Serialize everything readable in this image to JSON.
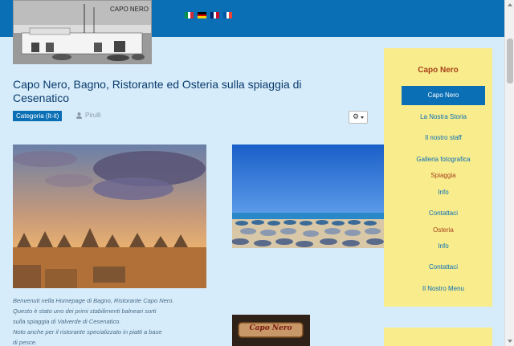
{
  "header": {
    "logo_text": "CAPO NERO",
    "flags": [
      {
        "name": "flag-italian-icon",
        "colors": [
          "#009246",
          "#ffffff",
          "#ce2b37"
        ]
      },
      {
        "name": "flag-german-icon",
        "colors": [
          "#000000",
          "#dd0000",
          "#ffce00"
        ]
      },
      {
        "name": "flag-english-icon",
        "colors": [
          "#012169",
          "#ffffff",
          "#c8102e"
        ]
      },
      {
        "name": "flag-french-icon",
        "colors": [
          "#0055a4",
          "#ffffff",
          "#ef4135"
        ]
      }
    ]
  },
  "article": {
    "title": "Capo Nero, Bagno, Ristorante ed Osteria sulla spiaggia di Cesenatico",
    "category": "Categoria (It-it)",
    "author": "Pirulli",
    "caption_lines": [
      "Benvenuti nella Homepage di Bagno, Ristorante Capo Nero.",
      "Questo è stato uno dei primi stabilimenti balneari sorti",
      "sulla spiaggia di Valverde di Cesenatico.",
      "Noto anche per il ristorante specializzato in piatti a base",
      "di pesce."
    ],
    "sign_text": "Capo Nero"
  },
  "sidebar": {
    "title": "Capo Nero",
    "items": [
      {
        "label": "Capo Nero",
        "active": true
      },
      {
        "label": "La Nostra Storia"
      },
      {
        "label": "Il nostro staff"
      },
      {
        "label": "Galleria fotografica"
      },
      {
        "label": "Spiaggia",
        "sub": true
      },
      {
        "label": "Info"
      },
      {
        "label": "Contattaci"
      },
      {
        "label": "Osteria",
        "sub": true
      },
      {
        "label": "Info"
      },
      {
        "label": "Contattaci"
      },
      {
        "label": "Il Nostro Menu"
      }
    ]
  },
  "colors": {
    "topbar": "#0a6fb5",
    "background": "#d6ecfa",
    "sidebar": "#f8ec8c",
    "accent_red": "#a8401a"
  }
}
